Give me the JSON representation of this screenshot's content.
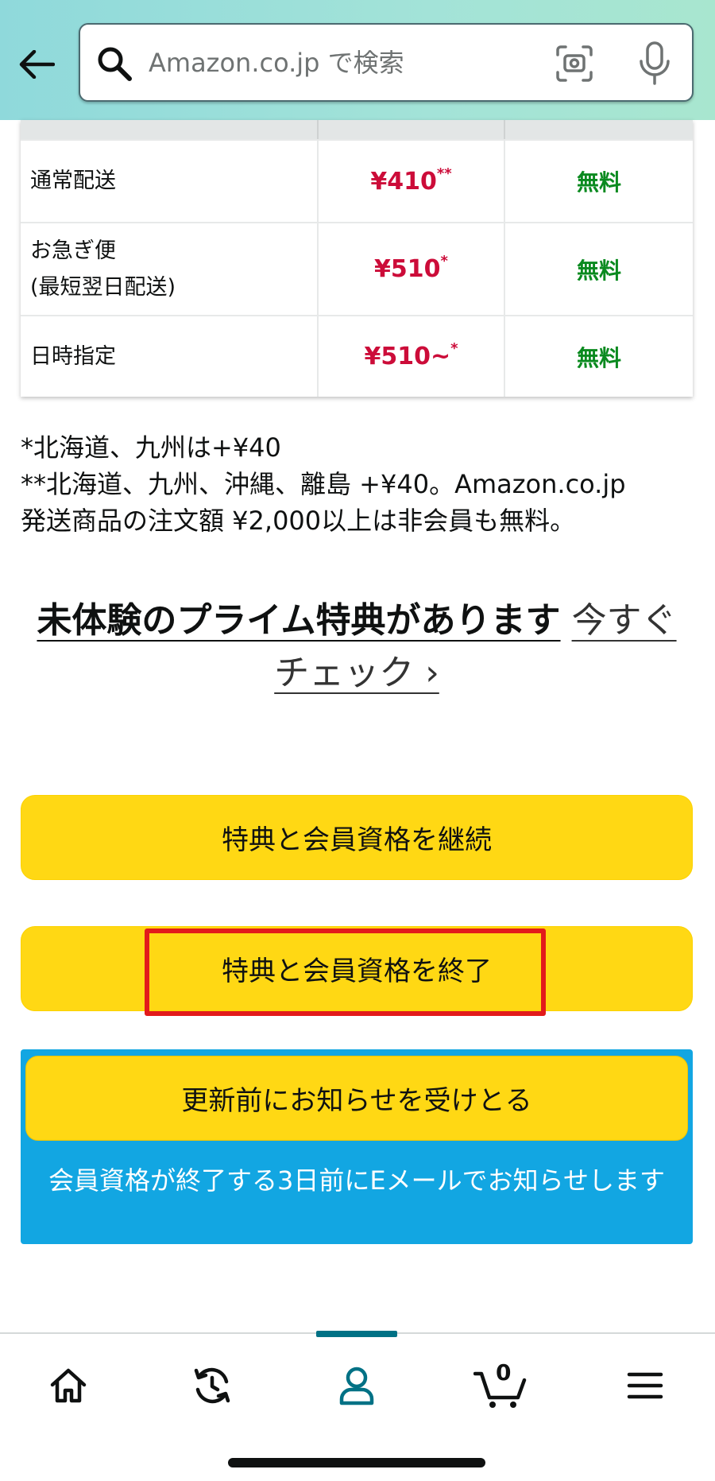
{
  "search": {
    "placeholder": "Amazon.co.jp で検索"
  },
  "shipping_table": {
    "rows": [
      {
        "label": "通常配送",
        "price": "¥410",
        "price_mark": "**",
        "member": "無料"
      },
      {
        "label_line1": "お急ぎ便",
        "label_line2": "(最短翌日配送)",
        "price": "¥510",
        "price_mark": "*",
        "member": "無料"
      },
      {
        "label": "日時指定",
        "price": "¥510~",
        "price_mark": "*",
        "member": "無料"
      }
    ]
  },
  "notes": {
    "line1": "*北海道、九州は+¥40",
    "line2": "**北海道、九州、沖縄、離島 +¥40。Amazon.co.jp",
    "line3": "発送商品の注文額 ¥2,000以上は非会員も無料。"
  },
  "prime_promo": {
    "headline": "未体験のプライム特典があります",
    "link_text": "今すぐチェック ›"
  },
  "buttons": {
    "continue_label": "特典と会員資格を継続",
    "end_label": "特典と会員資格を終了",
    "notify_label": "更新前にお知らせを受けとる"
  },
  "notify_description": "会員資格が終了する3日前にEメールでお知らせします",
  "bottom_nav": {
    "cart_count": "0",
    "items": [
      "home-icon",
      "history-icon",
      "account-icon",
      "cart-icon",
      "menu-icon"
    ],
    "active": "account-icon"
  },
  "colors": {
    "header_gradient_start": "#8fd9db",
    "header_gradient_end": "#a8e6cf",
    "price_red": "#cc0c39",
    "free_green": "#0a8a1f",
    "button_yellow": "#ffd814",
    "notify_blue": "#12a6e2",
    "highlight_red": "#e21b1b",
    "nav_active": "#007185"
  }
}
